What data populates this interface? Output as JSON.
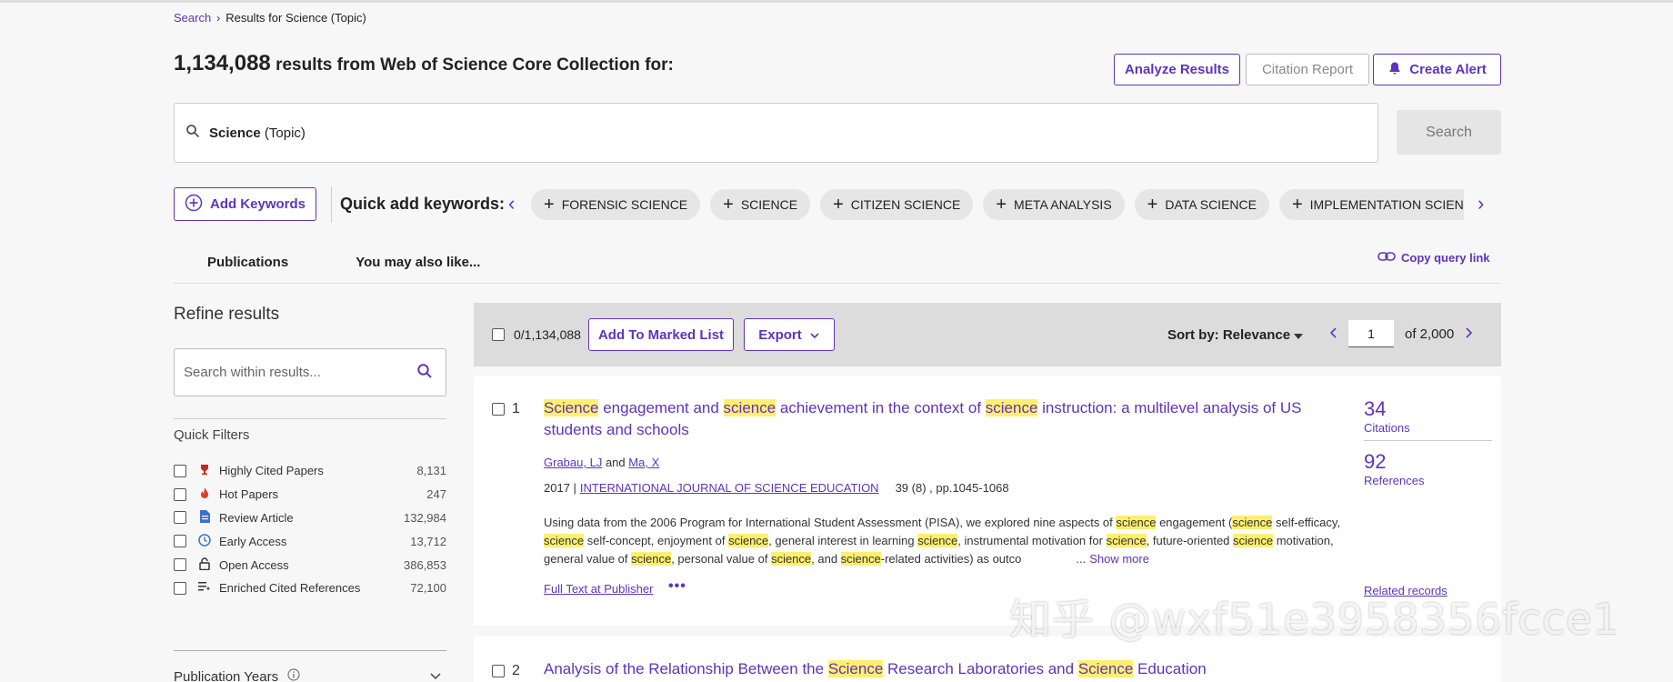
{
  "breadcrumb": {
    "search_link": "Search",
    "separator": "›",
    "current": "Results for Science (Topic)"
  },
  "results": {
    "count": "1,134,088",
    "rest": "results from Web of Science Core Collection for:"
  },
  "header_buttons": {
    "analyze": "Analyze Results",
    "citation_report": "Citation Report",
    "create_alert": "Create Alert"
  },
  "query": {
    "term": "Science",
    "field": "(Topic)",
    "search_button": "Search"
  },
  "keywords": {
    "add_button": "Add Keywords",
    "quick_add_label": "Quick add keywords:",
    "chips": [
      "FORENSIC SCIENCE",
      "SCIENCE",
      "CITIZEN SCIENCE",
      "META ANALYSIS",
      "DATA SCIENCE",
      "IMPLEMENTATION SCIENCE"
    ]
  },
  "tabs": {
    "publications": "Publications",
    "also_like": "You may also like..."
  },
  "copy_query_link": "Copy query link",
  "sidebar": {
    "refine_title": "Refine results",
    "search_placeholder": "Search within results...",
    "quick_filters_title": "Quick Filters",
    "filters": [
      {
        "label": "Highly Cited Papers",
        "count": "8,131",
        "icon": "trophy-icon"
      },
      {
        "label": "Hot Papers",
        "count": "247",
        "icon": "flame-icon"
      },
      {
        "label": "Review Article",
        "count": "132,984",
        "icon": "document-icon"
      },
      {
        "label": "Early Access",
        "count": "13,712",
        "icon": "clock-icon"
      },
      {
        "label": "Open Access",
        "count": "386,853",
        "icon": "unlock-icon"
      },
      {
        "label": "Enriched Cited References",
        "count": "72,100",
        "icon": "enriched-list-icon"
      }
    ],
    "publication_years": "Publication Years"
  },
  "toolbar": {
    "selected_count": "0/1,134,088",
    "add_marked": "Add To Marked List",
    "export": "Export",
    "sort_label": "Sort by:",
    "sort_value": "Relevance",
    "page": "1",
    "of_pages": "of 2,000"
  },
  "records": [
    {
      "num": "1",
      "title_parts": [
        "Science",
        " engagement and ",
        "science",
        " achievement in the context of ",
        "science",
        " instruction: a multilevel analysis of US students and schools"
      ],
      "author1": "Grabau, LJ",
      "and": "and",
      "author2": "Ma, X",
      "year": "2017 |",
      "journal": "INTERNATIONAL JOURNAL OF SCIENCE EDUCATION",
      "volume": "39 (8) , pp.1045-1068",
      "abstract_parts": [
        "Using data from the 2006 Program for International Student Assessment (PISA), we explored nine aspects of ",
        "science",
        " engagement (",
        "science",
        " self-efficacy, ",
        "science",
        " self-concept, enjoyment of ",
        "science",
        ", general interest in learning ",
        "science",
        ", instrumental motivation for ",
        "science",
        ", future-oriented ",
        "science",
        " motivation, general value of ",
        "science",
        ", personal value of ",
        "science",
        ", and ",
        "science",
        "-related activities) as outco"
      ],
      "ellipsis": "...",
      "show_more": "Show more",
      "full_text": "Full Text at Publisher",
      "more_options": "•••",
      "citations": "34",
      "citations_label": "Citations",
      "references": "92",
      "references_label": "References",
      "related": "Related records"
    },
    {
      "num": "2",
      "title_parts": [
        "Analysis of the Relationship Between the ",
        "Science",
        " Research Laboratories and ",
        "Science",
        " Education"
      ]
    }
  ],
  "watermark": "知乎 @wxf51e3958356fcce1",
  "colors": {
    "accent": "#5e33bf",
    "highlight": "#ffef6e",
    "toolbar_bg": "#dcdcdc"
  }
}
